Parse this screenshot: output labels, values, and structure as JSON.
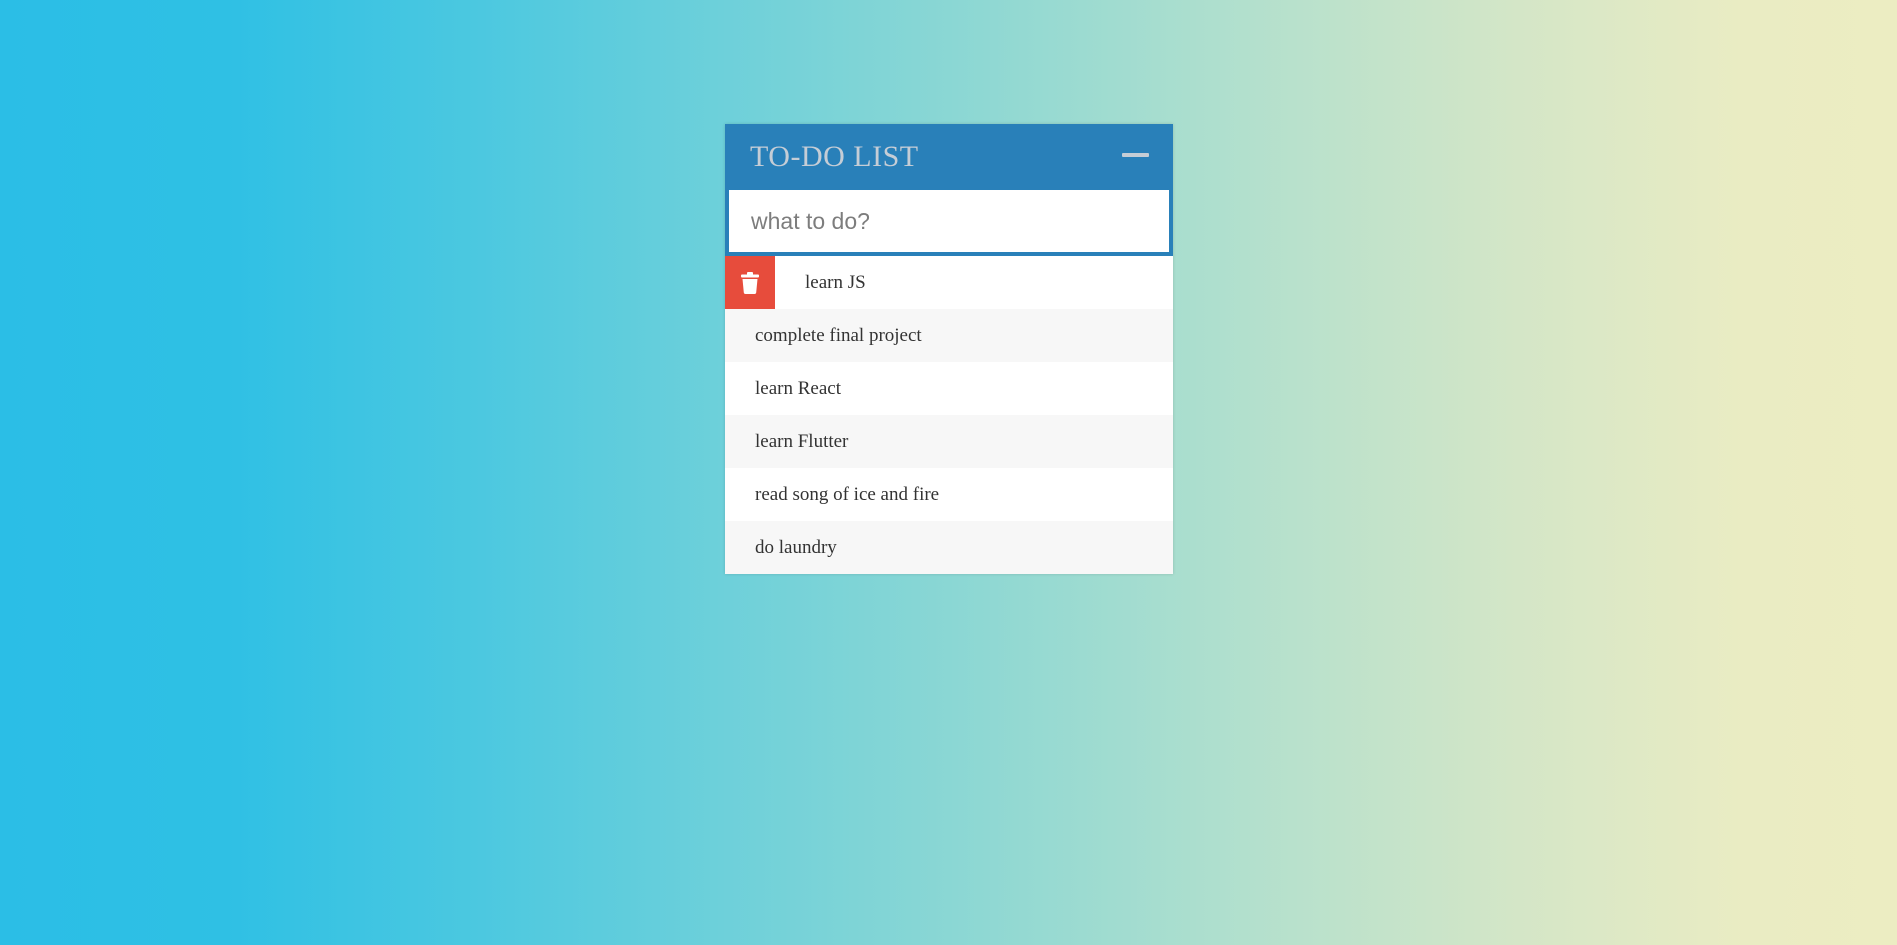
{
  "app": {
    "title": "TO-DO LIST"
  },
  "input": {
    "placeholder": "what to do?"
  },
  "todos": [
    {
      "label": "learn JS",
      "hovered": true
    },
    {
      "label": "complete final project"
    },
    {
      "label": "learn React"
    },
    {
      "label": "learn Flutter"
    },
    {
      "label": "read song of ice and fire"
    },
    {
      "label": "do laundry"
    }
  ],
  "icons": {
    "toggle": "minus-icon",
    "delete": "trash-icon"
  },
  "colors": {
    "header": "#2980b9",
    "title_text": "#c5cdd6",
    "delete_bg": "#e74c3c",
    "row_alt": "#f7f7f7"
  }
}
